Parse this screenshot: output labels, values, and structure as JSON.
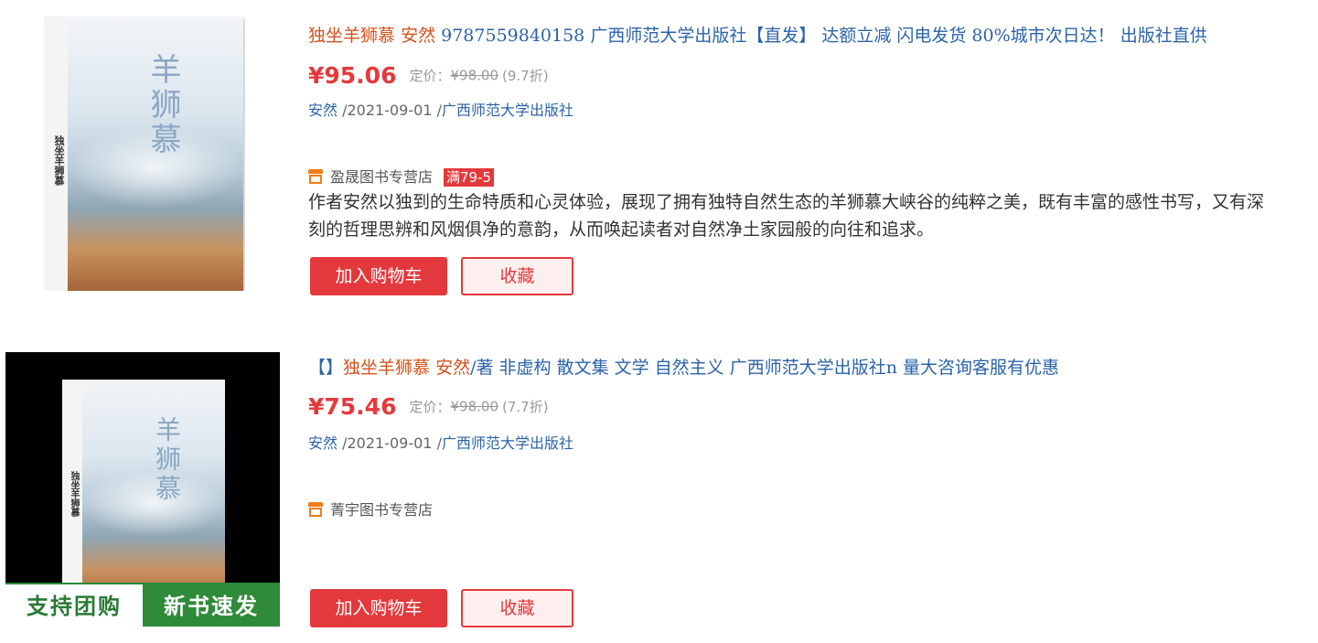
{
  "products": [
    {
      "cover": {
        "title": "羊狮慕",
        "spine": "独坐羊狮慕"
      },
      "title_parts": {
        "name": "独坐羊狮慕",
        "author": "安然",
        "rest": "9787559840158 广西师范大学出版社【直发】 达额立减 闪电发货 80%城市次日达！ 出版社直供"
      },
      "price": "¥95.06",
      "list_label": "定价：",
      "list_price": "¥98.00",
      "discount": "(9.7折)",
      "meta": {
        "author": "安然",
        "date": "/2021-09-01 /",
        "publisher": "广西师范大学出版社"
      },
      "shop": {
        "name": "盈晟图书专营店",
        "promo": "满79-5"
      },
      "description": "作者安然以独到的生命特质和心灵体验，展现了拥有独特自然生态的羊狮慕大峡谷的纯粹之美，既有丰富的感性书写，又有深刻的哲理思辨和风烟俱净的意韵，从而唤起读者对自然净土家园般的向往和追求。",
      "cart_label": "加入购物车",
      "fav_label": "收藏"
    },
    {
      "cover": {
        "title": "羊狮慕",
        "spine": "独坐羊狮慕",
        "promo_left": "支持团购",
        "promo_right": "新书速发"
      },
      "title_parts": {
        "bracket": "【】",
        "name": "独坐羊狮慕",
        "author": "安然",
        "rest": "/著 非虚构 散文集 文学 自然主义 广西师范大学出版社n 量大咨询客服有优惠"
      },
      "price": "¥75.46",
      "list_label": "定价：",
      "list_price": "¥98.00",
      "discount": "(7.7折)",
      "meta": {
        "author": "安然",
        "date": "/2021-09-01 /",
        "publisher": "广西师范大学出版社"
      },
      "shop": {
        "name": "菁宇图书专营店"
      },
      "cart_label": "加入购物车",
      "fav_label": "收藏"
    }
  ],
  "colors": {
    "price_red": "#e4393c",
    "link_blue": "#2b63a8",
    "title_orange": "#d4531f",
    "shop_icon": "#f07c1a"
  },
  "icons": {
    "shop": "store-icon"
  }
}
